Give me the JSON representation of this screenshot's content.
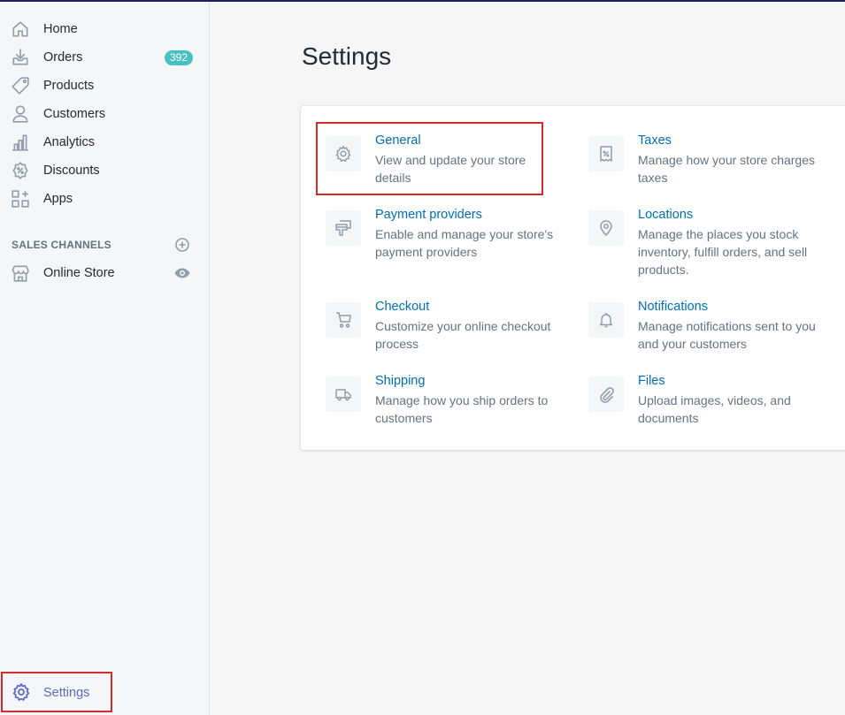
{
  "sidebar": {
    "items": [
      {
        "label": "Home",
        "icon": "home-icon"
      },
      {
        "label": "Orders",
        "icon": "orders-icon",
        "badge": "392"
      },
      {
        "label": "Products",
        "icon": "tag-icon"
      },
      {
        "label": "Customers",
        "icon": "person-icon"
      },
      {
        "label": "Analytics",
        "icon": "bar-chart-icon"
      },
      {
        "label": "Discounts",
        "icon": "discount-icon"
      },
      {
        "label": "Apps",
        "icon": "apps-icon"
      }
    ],
    "sales_channels_title": "SALES CHANNELS",
    "online_store": "Online Store",
    "settings": "Settings"
  },
  "page": {
    "title": "Settings"
  },
  "settings": [
    {
      "title": "General",
      "desc": "View and update your store details",
      "icon": "gear-icon"
    },
    {
      "title": "Taxes",
      "desc": "Manage how your store charges taxes",
      "icon": "receipt-icon"
    },
    {
      "title": "Payment providers",
      "desc": "Enable and manage your store's payment providers",
      "icon": "payment-icon"
    },
    {
      "title": "Locations",
      "desc": "Manage the places you stock inventory, fulfill orders, and sell products.",
      "icon": "location-pin-icon"
    },
    {
      "title": "Checkout",
      "desc": "Customize your online checkout process",
      "icon": "cart-icon"
    },
    {
      "title": "Notifications",
      "desc": "Manage notifications sent to you and your customers",
      "icon": "bell-icon"
    },
    {
      "title": "Shipping",
      "desc": "Manage how you ship orders to customers",
      "icon": "truck-icon"
    },
    {
      "title": "Files",
      "desc": "Upload images, videos, and documents",
      "icon": "paperclip-icon"
    }
  ],
  "colors": {
    "accent": "#5c6ac4",
    "link": "#006fbb",
    "badge": "#47c1bf",
    "highlight": "#d82c2c"
  }
}
